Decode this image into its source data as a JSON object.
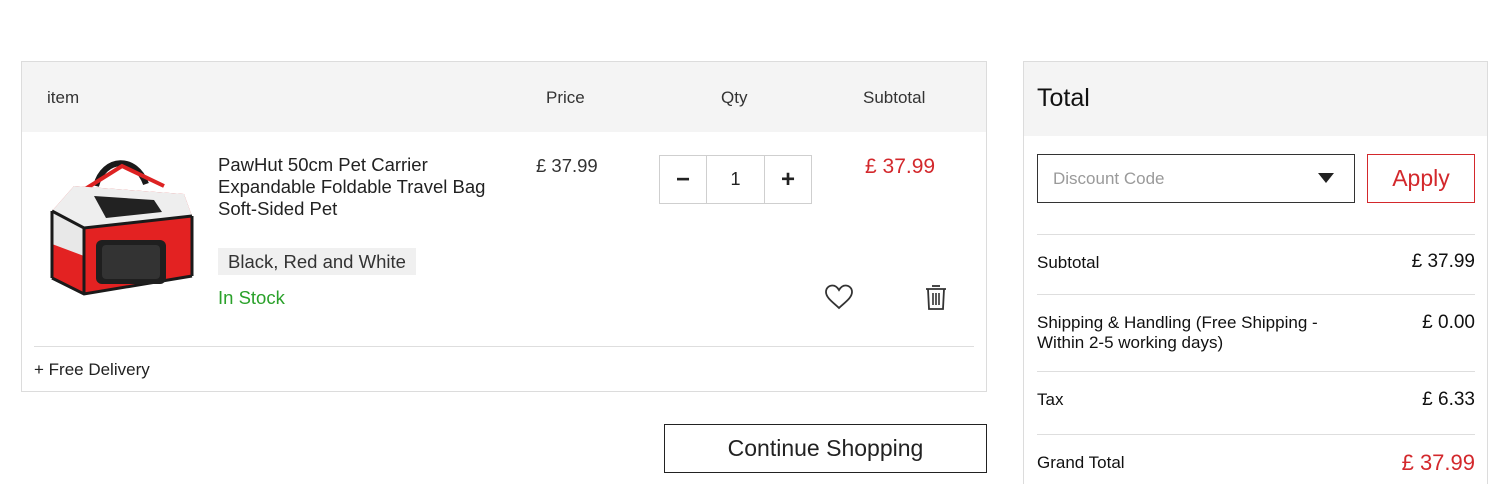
{
  "cart": {
    "headers": {
      "item": "item",
      "price": "Price",
      "qty": "Qty",
      "subtotal": "Subtotal"
    },
    "product": {
      "name": "PawHut 50cm Pet Carrier Expandable Foldable Travel Bag Soft-Sided Pet",
      "variant": "Black, Red and White",
      "stock": "In Stock",
      "price": "£ 37.99",
      "quantity": "1",
      "subtotal": "£ 37.99",
      "minus": "−",
      "plus": "+"
    },
    "delivery": "+ Free Delivery",
    "continue_label": "Continue Shopping"
  },
  "totals": {
    "title": "Total",
    "discount_placeholder": "Discount Code",
    "apply_label": "Apply",
    "rows": [
      {
        "label": "Subtotal",
        "value": "£ 37.99"
      },
      {
        "label": "Shipping & Handling (Free Shipping - Within 2-5 working days)",
        "value": "£ 0.00"
      },
      {
        "label": "Tax",
        "value": "£ 6.33"
      },
      {
        "label": "Grand Total",
        "value": "£ 37.99"
      }
    ]
  },
  "colors": {
    "accent": "#d3282c",
    "in_stock": "#2aa12a",
    "header_bg": "#f4f4f4"
  },
  "icons": [
    "pet-carrier-image",
    "minus-icon",
    "plus-icon",
    "heart-icon",
    "trash-icon",
    "chevron-down-icon"
  ]
}
